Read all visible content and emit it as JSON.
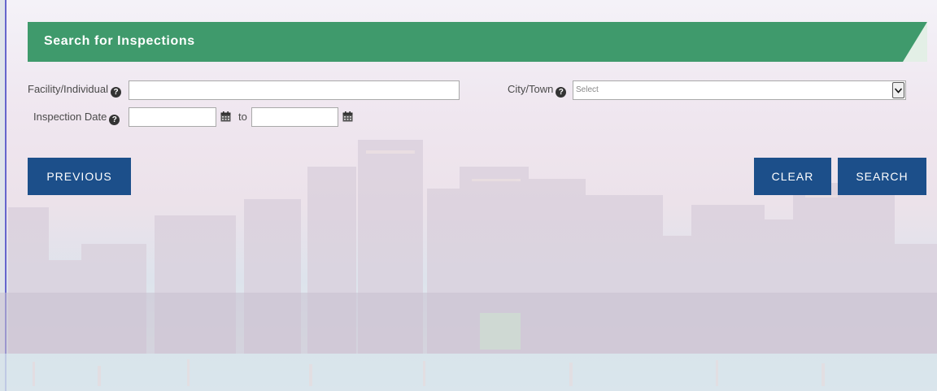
{
  "header": {
    "title": "Search for Inspections"
  },
  "form": {
    "facility_label": "Facility/Individual",
    "facility_value": "",
    "city_label": "City/Town",
    "city_selected": "Select",
    "date_label": "Inspection Date",
    "date_from_value": "",
    "date_to_value": "",
    "to_label": "to",
    "help_glyph": "?"
  },
  "buttons": {
    "previous": "PREVIOUS",
    "clear": "CLEAR",
    "search": "SEARCH"
  },
  "icons": {
    "help": "question-circle-icon",
    "calendar": "calendar-icon",
    "dropdown": "chevron-down-icon"
  },
  "colors": {
    "header_green": "#3f9a6c",
    "button_blue": "#1c4f8a"
  }
}
